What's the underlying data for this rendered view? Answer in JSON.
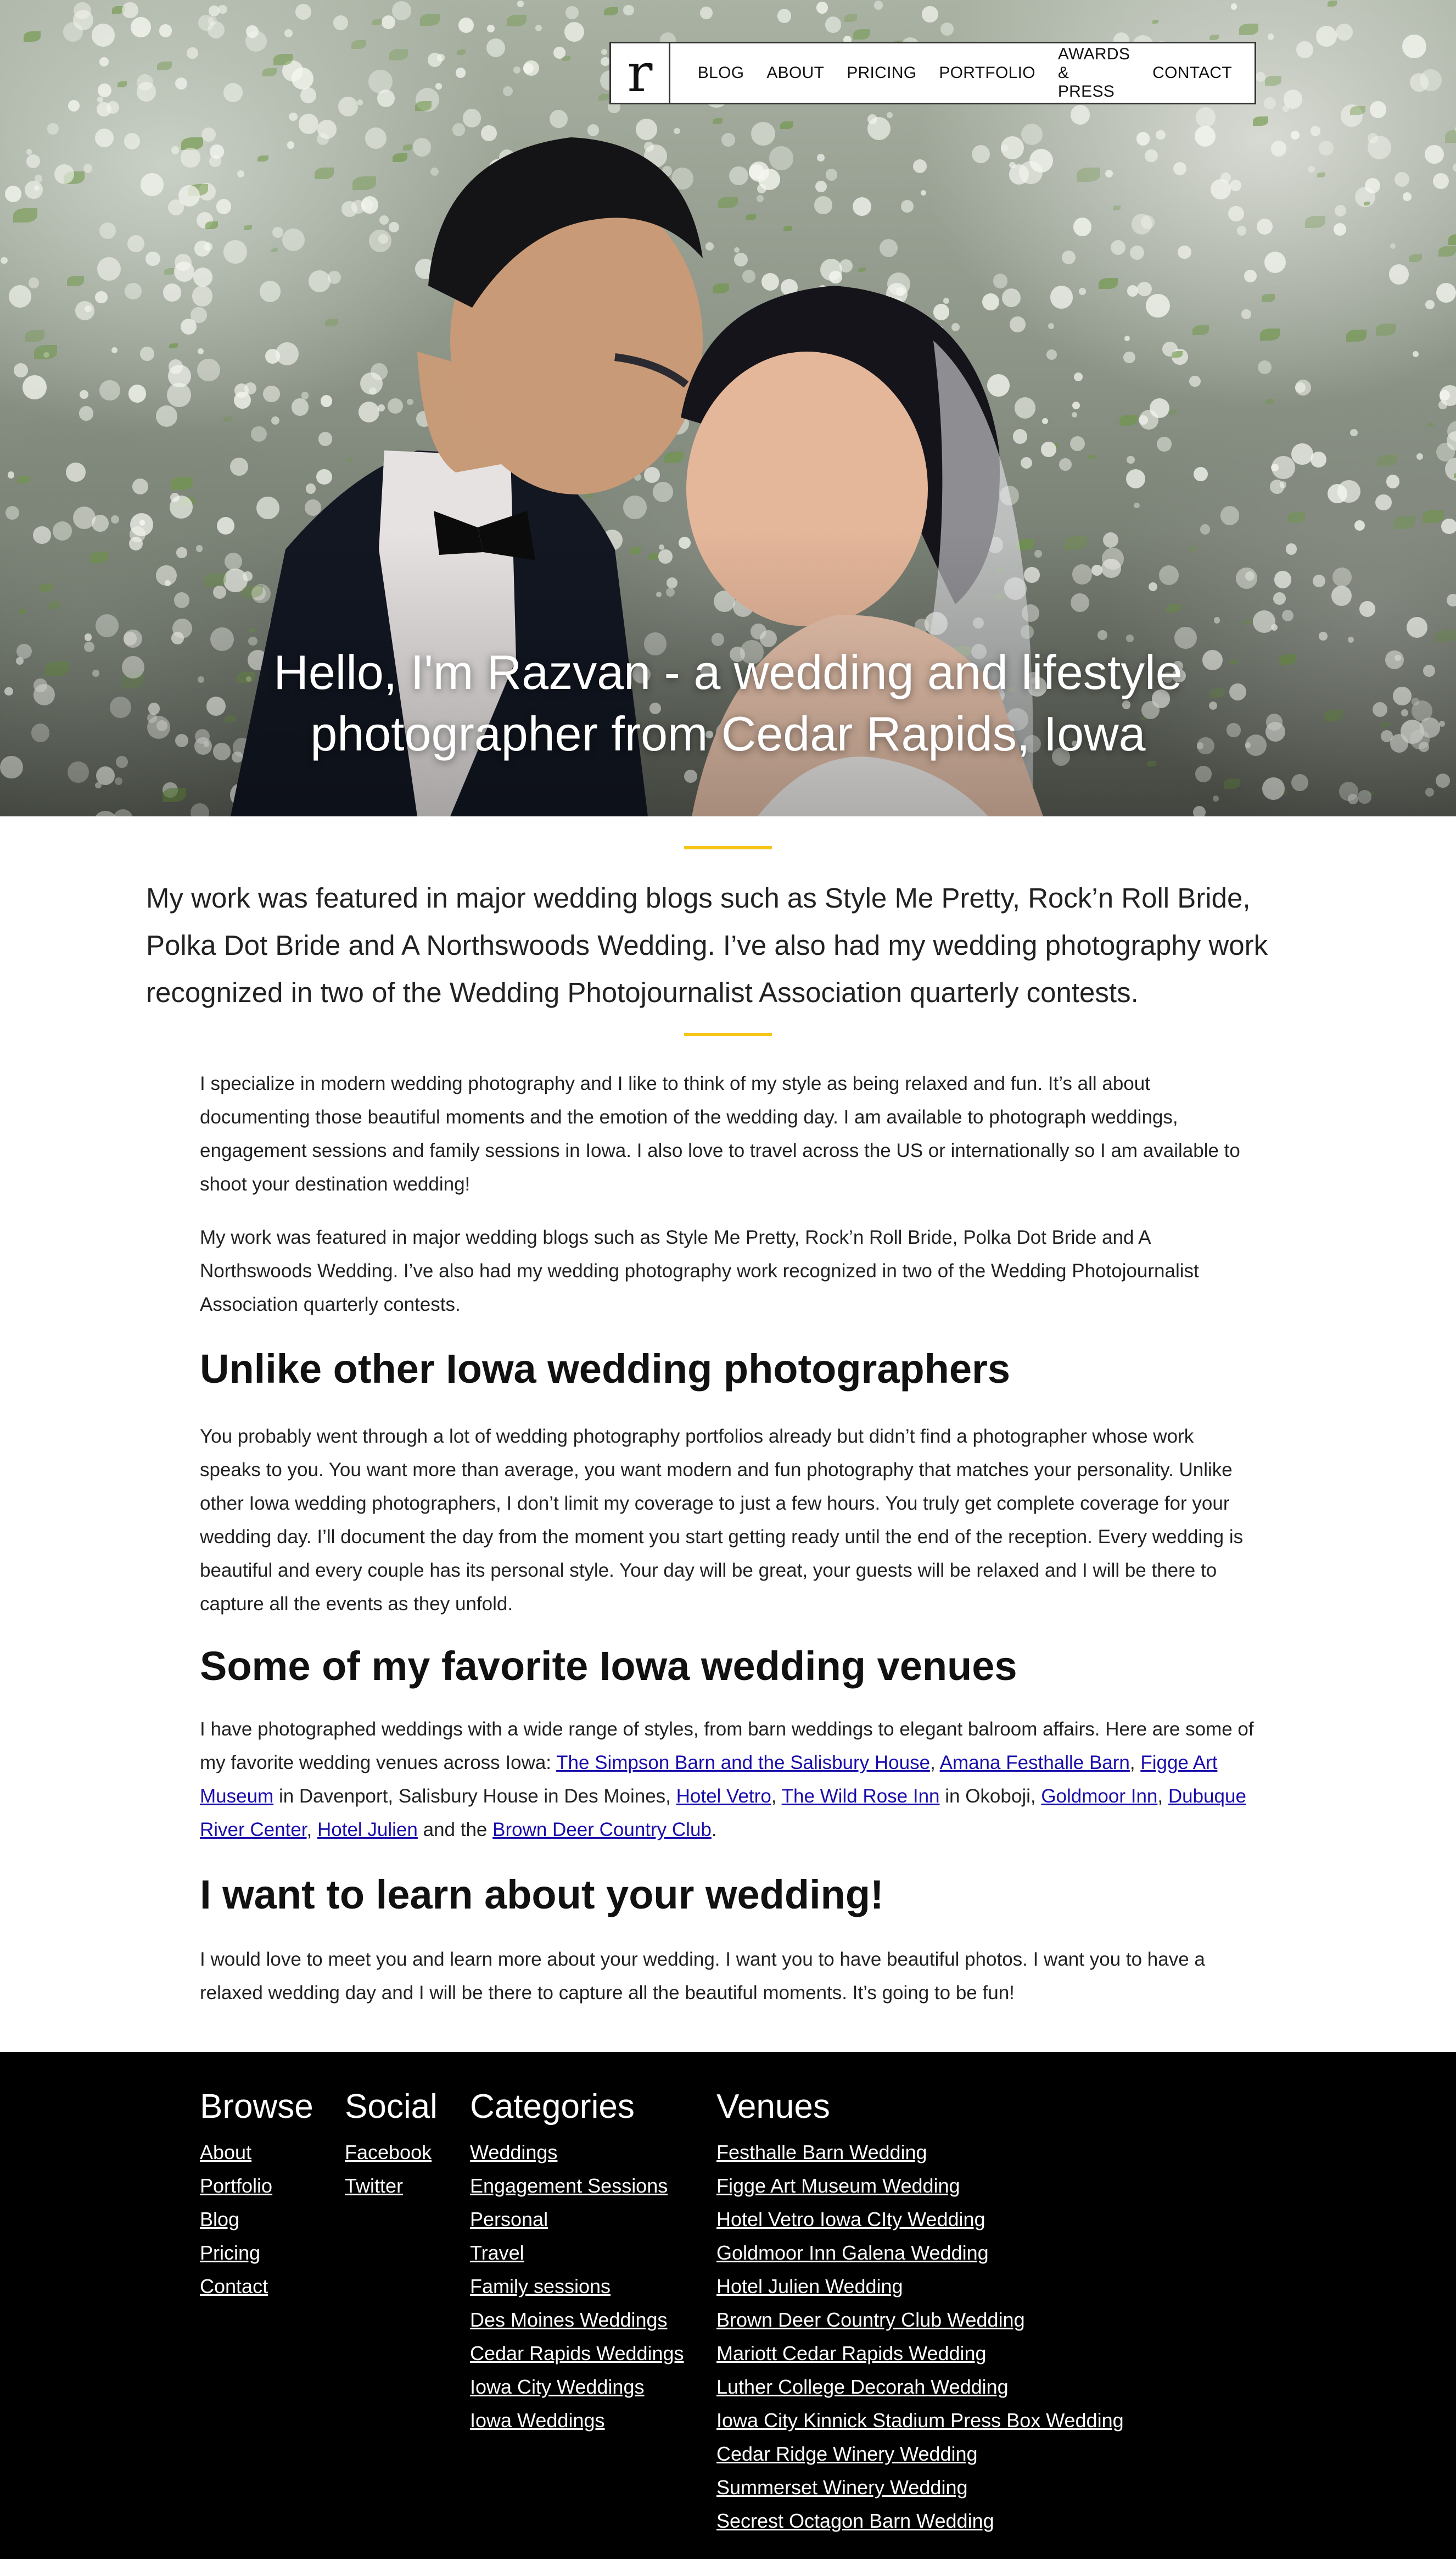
{
  "nav": {
    "logo": "r",
    "links": [
      "BLOG",
      "ABOUT",
      "PRICING",
      "PORTFOLIO",
      "AWARDS & PRESS",
      "CONTACT"
    ]
  },
  "hero": {
    "title_line1": "Hello, I'm Razvan - a wedding and lifestyle",
    "title_line2": "photographer from Cedar Rapids, Iowa"
  },
  "lead": "My work was featured in major wedding blogs such as Style Me Pretty, Rock’n Roll Bride, Polka Dot Bride and A Northswoods Wedding. I’ve also had my wedding photography work recognized in two of the Wedding Photojournalist Association quarterly contests.",
  "content": {
    "p1": "I specialize in modern wedding photography and I like to think of my style as being relaxed and fun. It’s all about documenting those beautiful moments and the emotion of the wedding day. I am available to photograph weddings, engagement sessions and family sessions in Iowa. I also love to travel across the US or internationally so I am available to shoot your destination wedding!",
    "p2": "My work was featured in major wedding blogs such as Style Me Pretty, Rock’n Roll Bride, Polka Dot Bride and A Northswoods Wedding. I’ve also had my wedding photography work recognized in two of the Wedding Photojournalist Association quarterly contests.",
    "h_unlike": "Unlike other Iowa wedding photographers",
    "p3": "You probably went through a lot of wedding photography portfolios already but didn’t find a photographer whose work speaks to you. You want more than average, you want modern and fun photography that matches your personality. Unlike other Iowa wedding photographers, I don’t limit my coverage to just a few hours. You truly get complete coverage for your wedding day. I’ll document the day from the moment you start getting ready until the end of the reception. Every wedding is beautiful and every couple has its personal style. Your day will be great, your guests will be relaxed and I will be there to capture all the events as they unfold.",
    "h_venues": "Some of my favorite Iowa wedding venues",
    "p4_intro": "I have photographed weddings with a wide range of styles, from barn weddings to elegant balroom affairs. Here are some of my favorite wedding venues across Iowa: ",
    "p4_link1": "The Simpson Barn and the Salisbury House",
    "p4_sep1": ", ",
    "p4_link2": "Amana Festhalle Barn",
    "p4_sep2": ", ",
    "p4_link3": "Figge Art Museum",
    "p4_mid1": " in Davenport, Salisbury House in Des Moines, ",
    "p4_link4": "Hotel Vetro",
    "p4_sep3": ", ",
    "p4_link5": "The Wild Rose Inn",
    "p4_mid2": " in Okoboji, ",
    "p4_link6": "Goldmoor Inn",
    "p4_sep4": ", ",
    "p4_link7": "Dubuque River Center",
    "p4_sep5": ", ",
    "p4_link8": "Hotel Julien",
    "p4_mid3": " and the ",
    "p4_link9": "Brown Deer Country Club",
    "p4_end": ".",
    "h_learn": "I want to learn about your wedding!",
    "p5": "I would love to meet you and learn more about your wedding. I want you to have beautiful photos. I want you to have a relaxed wedding day and I will be there to capture all the beautiful moments. It’s going to be fun!"
  },
  "footer": {
    "browse": {
      "title": "Browse",
      "links": [
        "About",
        "Portfolio",
        "Blog",
        "Pricing",
        "Contact"
      ]
    },
    "social": {
      "title": "Social",
      "links": [
        "Facebook",
        "Twitter"
      ]
    },
    "categories": {
      "title": "Categories",
      "links": [
        "Weddings",
        "Engagement Sessions",
        "Personal",
        "Travel",
        "Family sessions",
        "Des Moines Weddings",
        "Cedar Rapids Weddings",
        "Iowa City Weddings",
        "Iowa Weddings"
      ]
    },
    "venues": {
      "title": "Venues",
      "links": [
        "Festhalle Barn Wedding",
        "Figge Art Museum Wedding",
        "Hotel Vetro Iowa CIty Wedding",
        "Goldmoor Inn Galena Wedding",
        "Hotel Julien Wedding",
        "Brown Deer Country Club Wedding",
        "Mariott Cedar Rapids Wedding",
        "Luther College Decorah Wedding",
        "Iowa City Kinnick Stadium Press Box Wedding",
        "Cedar Ridge Winery Wedding",
        "Summerset Winery Wedding",
        "Secrest Octagon Barn Wedding"
      ]
    }
  },
  "colors": {
    "accent": "#f5c518",
    "link": "#1a0dab",
    "footer_bg": "#000000"
  }
}
